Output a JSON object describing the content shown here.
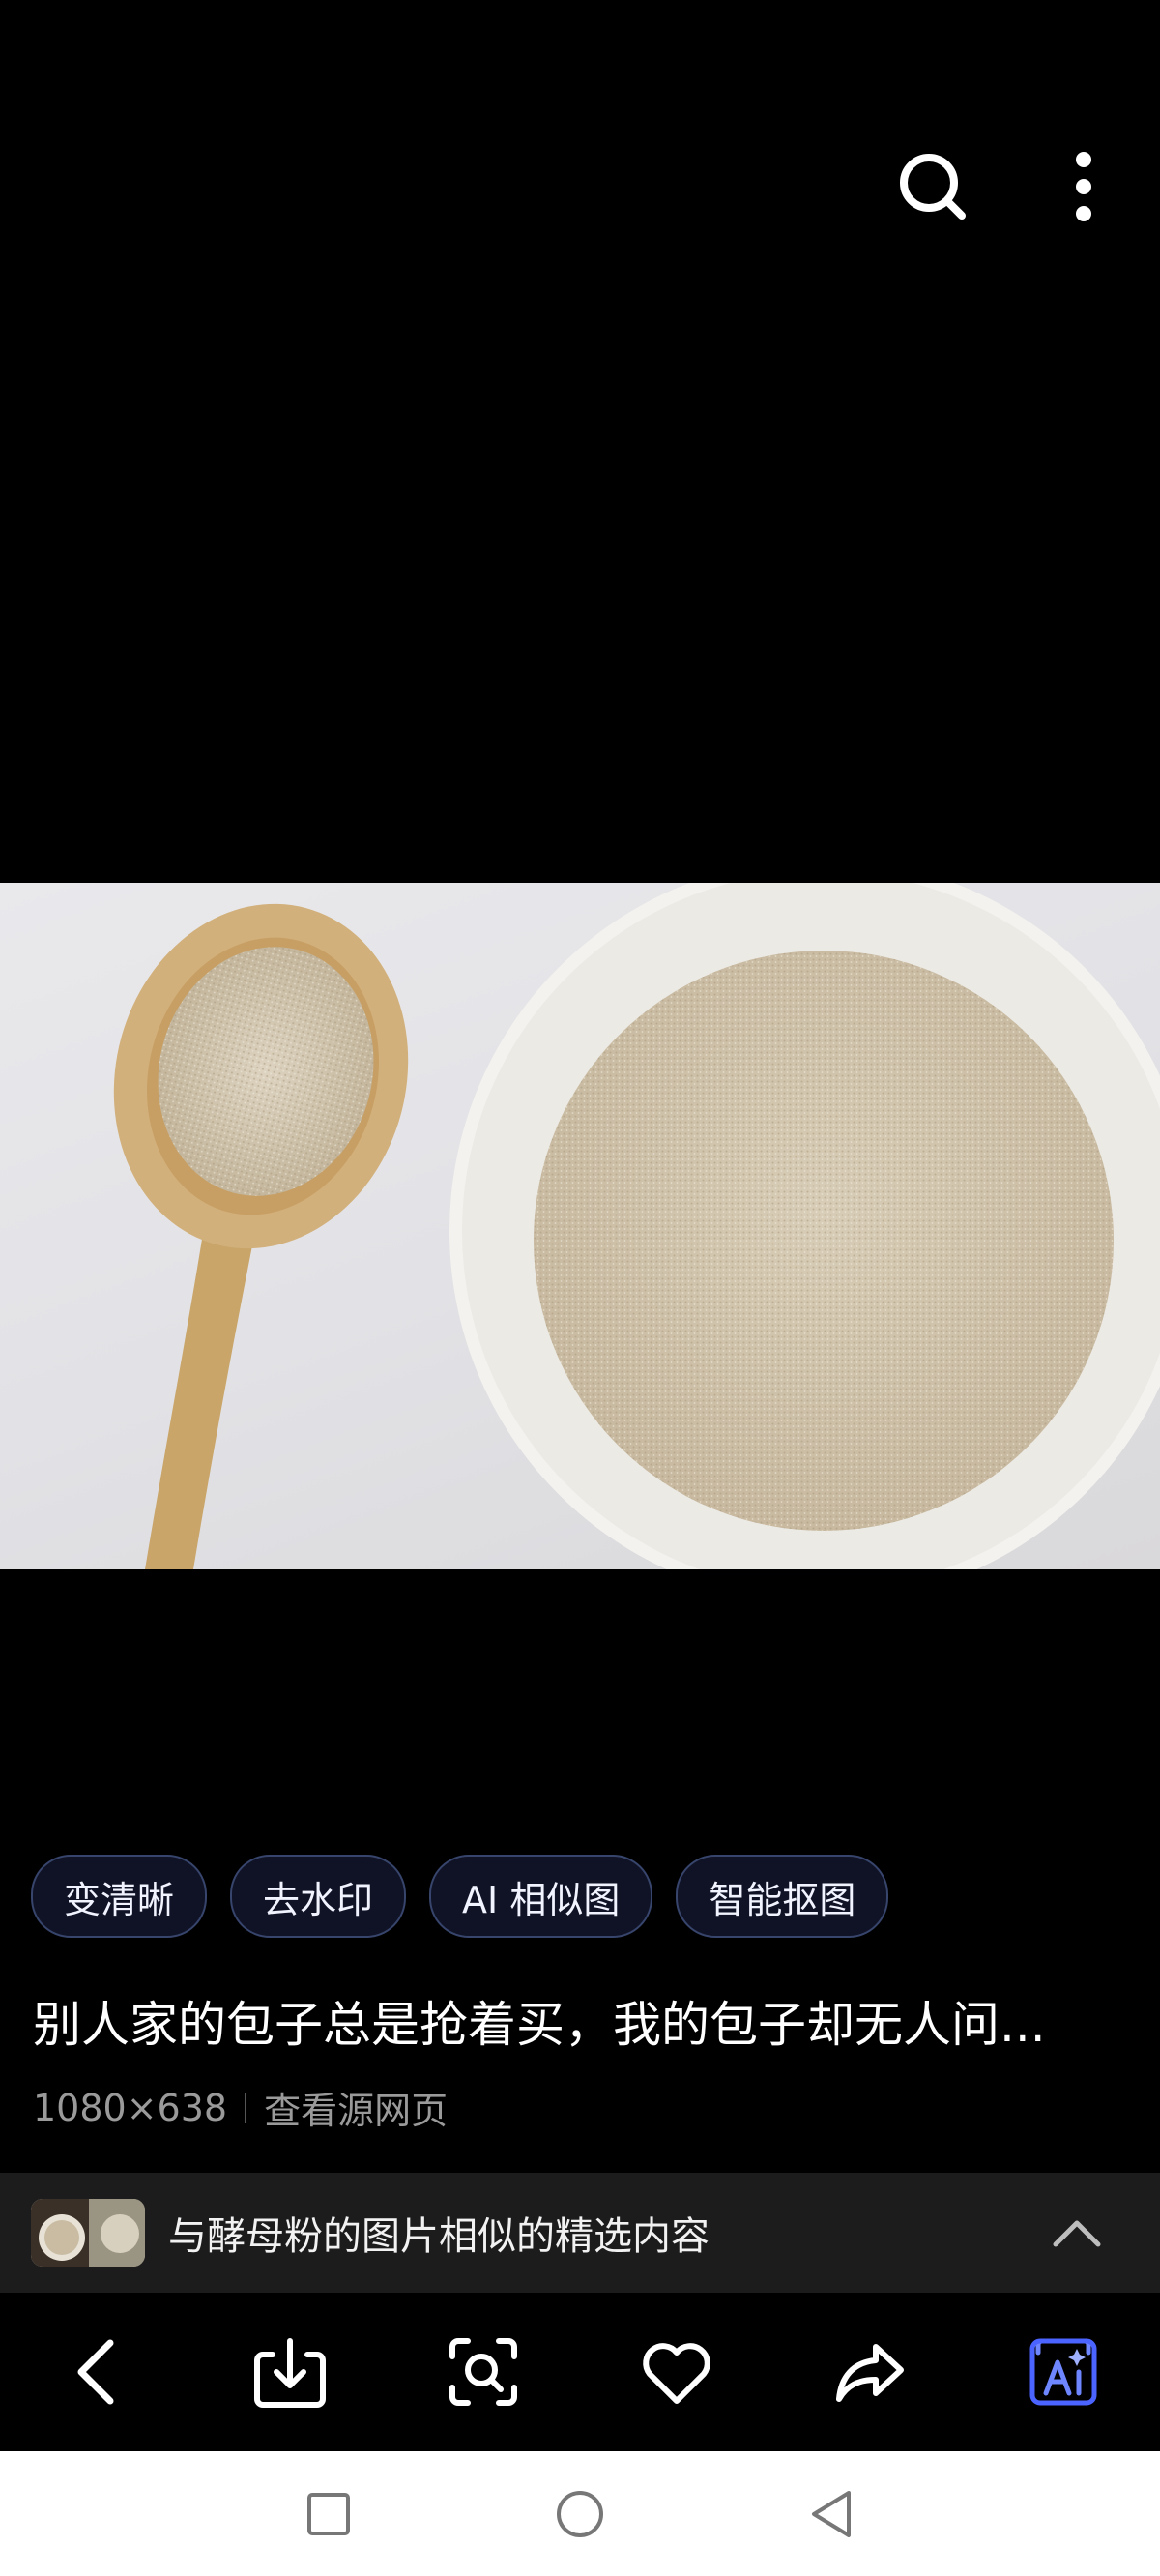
{
  "header": {
    "search_icon": "search-icon",
    "more_icon": "more-vertical-icon"
  },
  "image": {
    "description_alt": "酵母粉"
  },
  "chips": [
    {
      "label": "变清晰"
    },
    {
      "label": "去水印"
    },
    {
      "label": "AI 相似图"
    },
    {
      "label": "智能抠图"
    }
  ],
  "title": "别人家的包子总是抢着买，我的包子却无人问...",
  "meta": {
    "dimensions": "1080×638",
    "source_link": "查看源网页"
  },
  "similar": {
    "label": "与酵母粉的图片相似的精选内容"
  },
  "toolbar": {
    "back_icon": "back-icon",
    "download_icon": "download-icon",
    "lens_icon": "lens-search-icon",
    "favorite_icon": "heart-icon",
    "share_icon": "share-icon",
    "ai_icon": "ai-icon",
    "ai_accent": "#4b63ff"
  },
  "navbar": {
    "recent_icon": "square-icon",
    "home_icon": "circle-icon",
    "back_icon": "triangle-back-icon"
  }
}
